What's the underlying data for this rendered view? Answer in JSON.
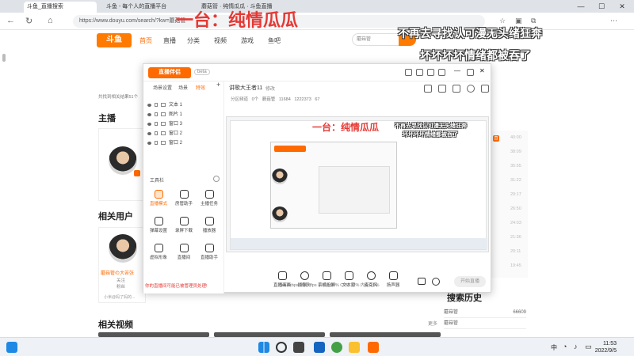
{
  "browser": {
    "tabs": [
      {
        "label": "斗鱼_直播搜索",
        "active": true
      },
      {
        "label": "斗鱼 - 每个人的直播平台",
        "active": false
      },
      {
        "label": "蘑菇管 · 纯情瓜瓜 · 斗鱼直播",
        "active": false
      }
    ],
    "url": "https://www.douyu.com/search/?kw=蘑菇管",
    "window_controls": [
      "—",
      "☐",
      "✕"
    ]
  },
  "overlays": {
    "title": "一台：纯情瓜瓜",
    "line1": "不再去寻找认可漫无头绪狂奔",
    "line2": "坏坏坏坏情绪都被吞了"
  },
  "site": {
    "logo": "斗鱼",
    "nav": [
      "首页",
      "直播",
      "分类",
      "视频",
      "游戏",
      "鱼吧"
    ],
    "search_value": "蘑菇管",
    "result_hint": "共找到相关结果51个",
    "section_anchor": "主播",
    "section_users": "相关用户",
    "section_videos": "相关视频",
    "user_name": "蘑菇管の大苦张",
    "user_fans": "关注",
    "user_follow": "粉丝",
    "user_desc": "小米@妈了妈的...",
    "more": "更多",
    "history_title": "搜索历史",
    "history": [
      {
        "k": "蘑菇管",
        "v": "66609"
      },
      {
        "k": "蘑菇管",
        "v": ""
      },
      {
        "k": "",
        "v": ""
      }
    ],
    "right_rank": [
      "40:00",
      "38:09",
      "35:55",
      "31:22",
      "29:17",
      "26:50",
      "24:03",
      "21:36",
      "20:11",
      "19:45"
    ],
    "right_badge": "直"
  },
  "obs": {
    "logo": "直播伴侣",
    "badge": "beta",
    "left_tabs": [
      "场景设置",
      "场景",
      "特效"
    ],
    "scenes": [
      "文本 1",
      "图片 1",
      "窗口 3",
      "窗口 2",
      "窗口 2"
    ],
    "tools_title": "工具栏",
    "tools": [
      {
        "label": "直播模式",
        "accent": true
      },
      {
        "label": "房管助手",
        "accent": false
      },
      {
        "label": "主播任务",
        "accent": false
      },
      {
        "label": "弹幕设置",
        "accent": false
      },
      {
        "label": "录屏下载",
        "accent": false
      },
      {
        "label": "播放器",
        "accent": false
      },
      {
        "label": "虚拟形象",
        "accent": false
      },
      {
        "label": "直播间",
        "accent": false
      },
      {
        "label": "直播助手",
        "accent": false
      }
    ],
    "notice": "你的直播间可能已被管理员处理!",
    "room_title": "讲歌大王者11",
    "room_tag": "修改",
    "stats": [
      "分区频道",
      "0个",
      "蘑菇管",
      "11684",
      "1222373",
      "67"
    ],
    "bottom_tools": [
      "直播画面",
      "摄像头",
      "手机投屏",
      "文本源",
      "麦克风",
      "扬声器"
    ],
    "start_label": "开始直播",
    "status_line": "码率0kbps 帧率0fps 丢帧0.00% CPU 12% 内存0.5%",
    "preview_title": "一台：纯情瓜瓜",
    "preview_line1": "不再去寻找认可漫无头绪狂奔",
    "preview_line2": "坏坏坏坏情绪都被吞了"
  },
  "taskbar": {
    "time": "11:53",
    "date": "2022/9/5",
    "ime": "中"
  }
}
